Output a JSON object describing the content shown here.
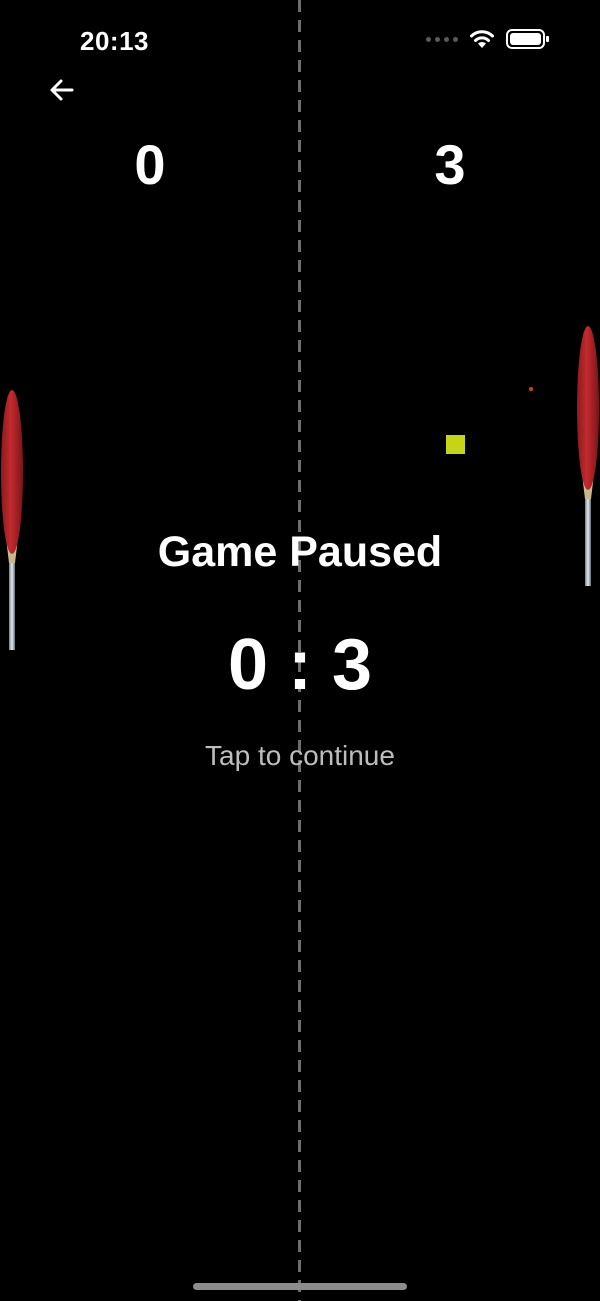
{
  "status_bar": {
    "time": "20:13",
    "icons": [
      "cellular-dots-icon",
      "wifi-icon",
      "battery-icon"
    ]
  },
  "navigation": {
    "back_icon": "arrow-left-icon"
  },
  "scores": {
    "left": "0",
    "right": "3"
  },
  "pause_overlay": {
    "title": "Game Paused",
    "score_text": "0 : 3",
    "hint": "Tap to continue"
  },
  "colors": {
    "background": "#000000",
    "paddle": "#b3262a",
    "ball": "#c5d416",
    "net": "#6d6d6d",
    "hint_text": "#bdbdbd"
  }
}
